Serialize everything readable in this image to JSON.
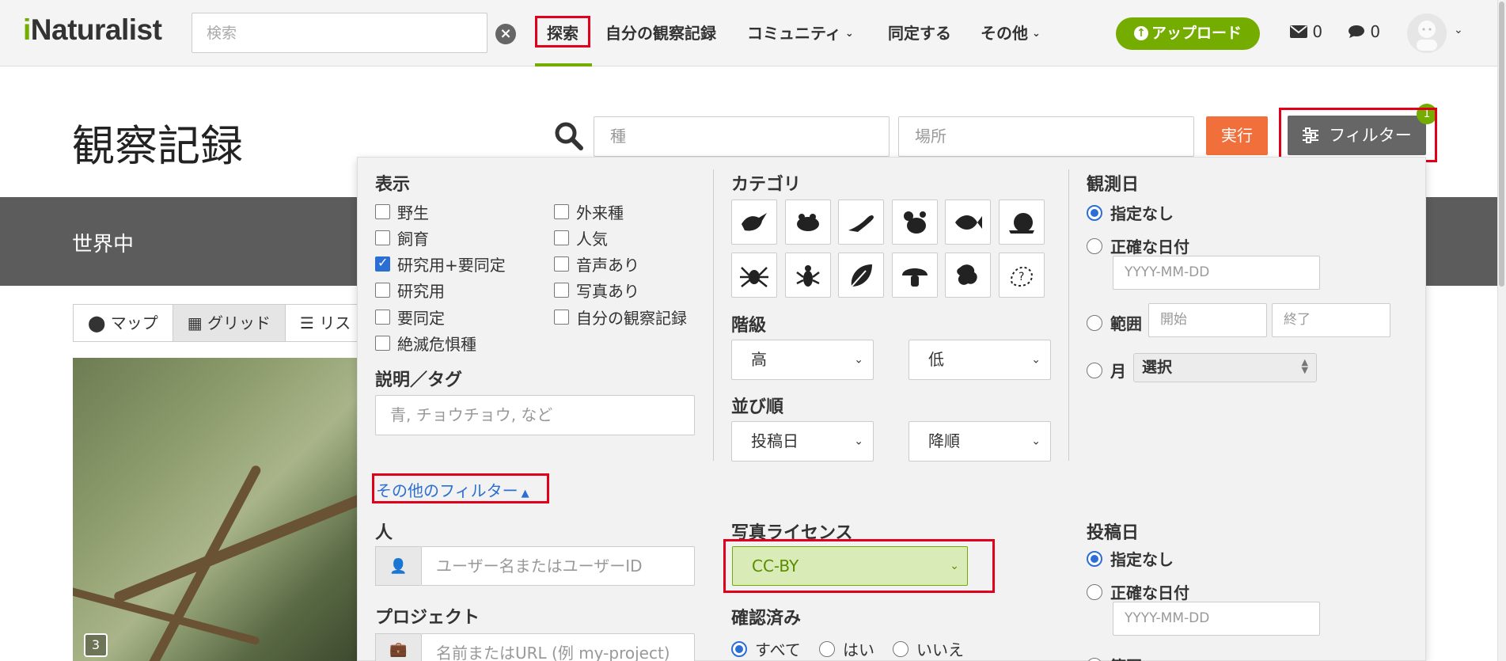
{
  "navbar": {
    "logo": "iNaturalist",
    "search_placeholder": "検索",
    "items": [
      {
        "label": "探索"
      },
      {
        "label": "自分の観察記録"
      },
      {
        "label": "コミュニティ"
      },
      {
        "label": "同定する"
      },
      {
        "label": "その他"
      }
    ],
    "upload_label": "アップロード",
    "messages_count": "0",
    "comments_count": "0"
  },
  "header": {
    "title": "観察記録",
    "species_placeholder": "種",
    "place_placeholder": "場所",
    "go_label": "実行",
    "filter_label": "フィルター",
    "filter_badge": "1"
  },
  "band": {
    "place": "世界中"
  },
  "view_tabs": [
    {
      "label": "マップ",
      "icon": "map-marker-icon"
    },
    {
      "label": "グリッド",
      "icon": "grid-icon"
    },
    {
      "label": "リス",
      "icon": "list-icon"
    }
  ],
  "photo": {
    "count": "3"
  },
  "filters": {
    "show": {
      "title": "表示",
      "left": [
        {
          "label": "野生",
          "checked": false
        },
        {
          "label": "飼育",
          "checked": false
        },
        {
          "label": "研究用+要同定",
          "checked": true
        },
        {
          "label": "研究用",
          "checked": false
        },
        {
          "label": "要同定",
          "checked": false
        },
        {
          "label": "絶滅危惧種",
          "checked": false
        }
      ],
      "right": [
        {
          "label": "外来種",
          "checked": false
        },
        {
          "label": "人気",
          "checked": false
        },
        {
          "label": "音声あり",
          "checked": false
        },
        {
          "label": "写真あり",
          "checked": false
        },
        {
          "label": "自分の観察記録",
          "checked": false
        }
      ]
    },
    "description": {
      "title": "説明／タグ",
      "placeholder": "青, チョウチョウ, など"
    },
    "more_filters_label": "その他のフィルター",
    "category": {
      "title": "カテゴリ",
      "icons": [
        "birds-icon",
        "amphibians-icon",
        "reptiles-icon",
        "mammals-icon",
        "fish-icon",
        "mollusks-icon",
        "arachnids-icon",
        "insects-icon",
        "plants-icon",
        "fungi-icon",
        "protozoa-icon",
        "unknown-icon"
      ]
    },
    "rank": {
      "title": "階級",
      "high": "高",
      "low": "低"
    },
    "sort": {
      "title": "並び順",
      "by": "投稿日",
      "order": "降順"
    },
    "observed_date": {
      "title": "観測日",
      "any": "指定なし",
      "exact": "正確な日付",
      "date_placeholder": "YYYY-MM-DD",
      "range": "範囲",
      "start_placeholder": "開始",
      "end_placeholder": "終了",
      "month": "月",
      "month_select": "選択"
    },
    "person": {
      "title": "人",
      "placeholder": "ユーザー名またはユーザーID"
    },
    "project": {
      "title": "プロジェクト",
      "placeholder": "名前またはURL (例 my-project)"
    },
    "photo_license": {
      "title": "写真ライセンス",
      "value": "CC-BY"
    },
    "reviewed": {
      "title": "確認済み",
      "options": [
        "すべて",
        "はい",
        "いいえ"
      ]
    },
    "created_date": {
      "title": "投稿日",
      "any": "指定なし",
      "exact": "正確な日付",
      "date_placeholder": "YYYY-MM-DD",
      "range": "範囲"
    }
  },
  "colors": {
    "brand": "#74ac00",
    "go": "#f16f3a",
    "highlight": "#e0001a",
    "link": "#2b6fd4"
  }
}
